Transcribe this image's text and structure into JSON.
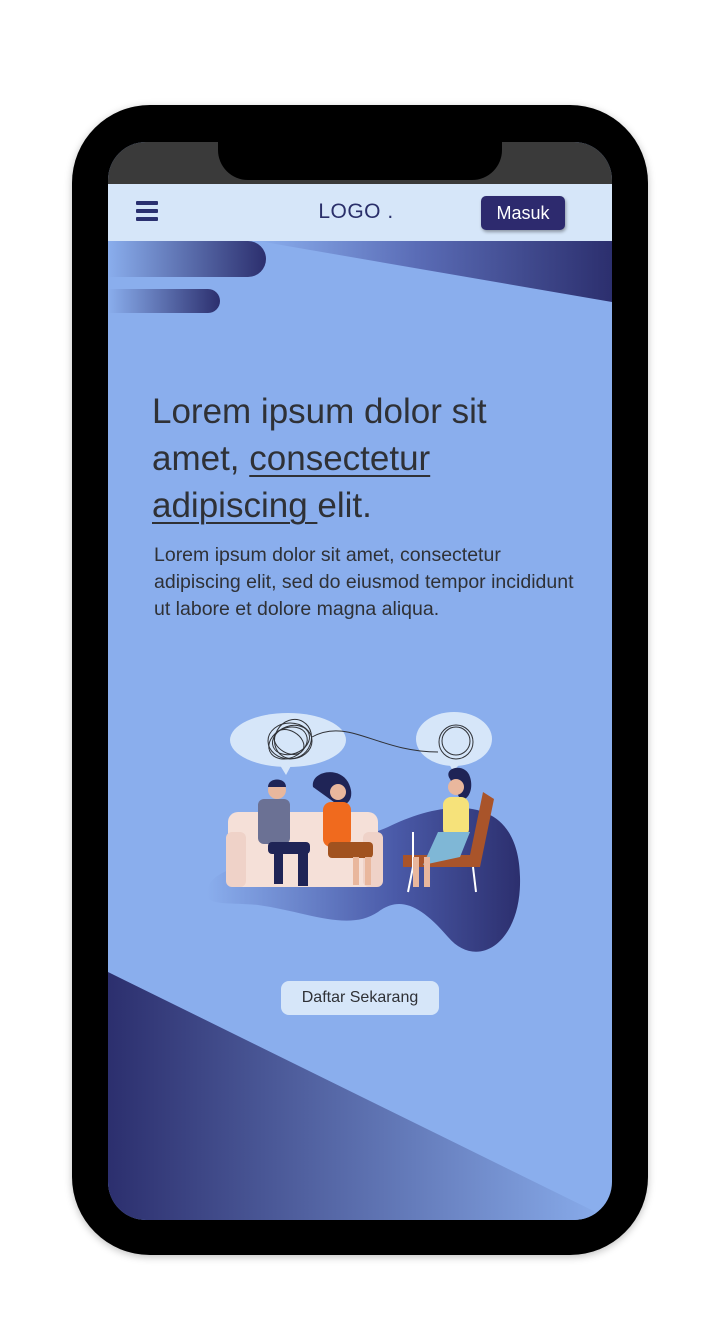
{
  "navbar": {
    "logo": "LOGO .",
    "login_label": "Masuk"
  },
  "hero": {
    "headline_part1": "Lorem ipsum dolor sit amet, ",
    "headline_link1": "consectetur adipiscing ",
    "headline_part2": "elit.",
    "subtext": "Lorem ipsum dolor sit amet, consectetur adipiscing elit, sed do eiusmod tempor incididunt ut labore et dolore magna aliqua.",
    "cta_label": "Daftar Sekarang"
  },
  "colors": {
    "screen_bg": "#8aaeed",
    "navbar_bg": "#d6e6f9",
    "accent_dark": "#2d2a6e",
    "text": "#2f3136"
  },
  "icons": [
    "menu-icon"
  ]
}
